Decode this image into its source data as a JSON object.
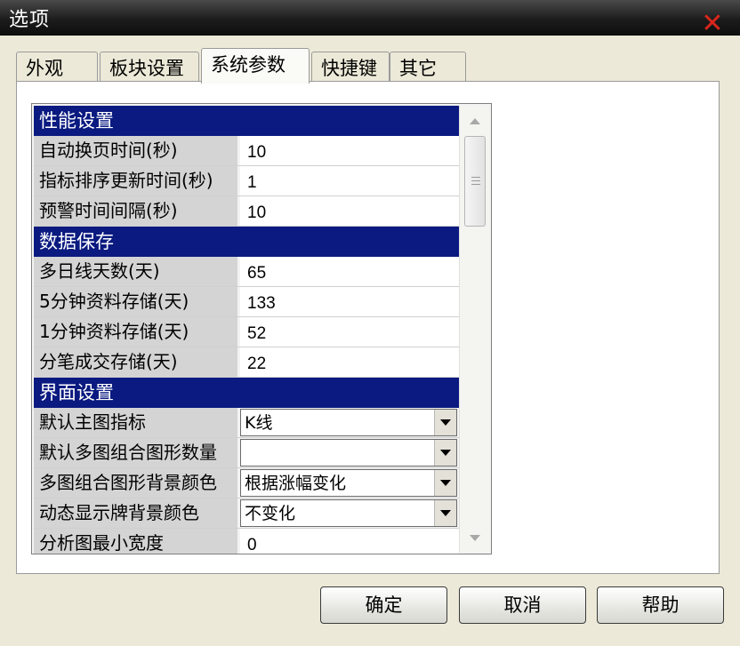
{
  "window": {
    "title": "选项",
    "close_label": "✕"
  },
  "tabs": [
    {
      "label": "外观"
    },
    {
      "label": "板块设置"
    },
    {
      "label": "系统参数",
      "active": true
    },
    {
      "label": "快捷键"
    },
    {
      "label": "其它"
    }
  ],
  "grid": {
    "sections": [
      {
        "title": "性能设置",
        "rows": [
          {
            "label": "自动换页时间(秒)",
            "value": "10"
          },
          {
            "label": "指标排序更新时间(秒)",
            "value": "1"
          },
          {
            "label": "预警时间间隔(秒)",
            "value": "10"
          }
        ]
      },
      {
        "title": "数据保存",
        "rows": [
          {
            "label": "多日线天数(天)",
            "value": "65"
          },
          {
            "label": "5分钟资料存储(天)",
            "value": "133"
          },
          {
            "label": "1分钟资料存储(天)",
            "value": "52"
          },
          {
            "label": "分笔成交存储(天)",
            "value": "22"
          }
        ]
      },
      {
        "title": "界面设置",
        "rows": [
          {
            "label": "默认主图指标",
            "value": "K线",
            "dropdown": true
          },
          {
            "label": "默认多图组合图形数量",
            "value": "",
            "dropdown": true
          },
          {
            "label": "多图组合图形背景颜色",
            "value": "根据涨幅变化",
            "dropdown": true
          },
          {
            "label": "动态显示牌背景颜色",
            "value": "不变化",
            "dropdown": true
          },
          {
            "label": "分析图最小宽度",
            "value": "0"
          }
        ]
      }
    ]
  },
  "buttons": {
    "ok": "确定",
    "cancel": "取消",
    "help": "帮助"
  },
  "colors": {
    "section_header": "#0a1a80",
    "close_icon": "#d9261c"
  }
}
